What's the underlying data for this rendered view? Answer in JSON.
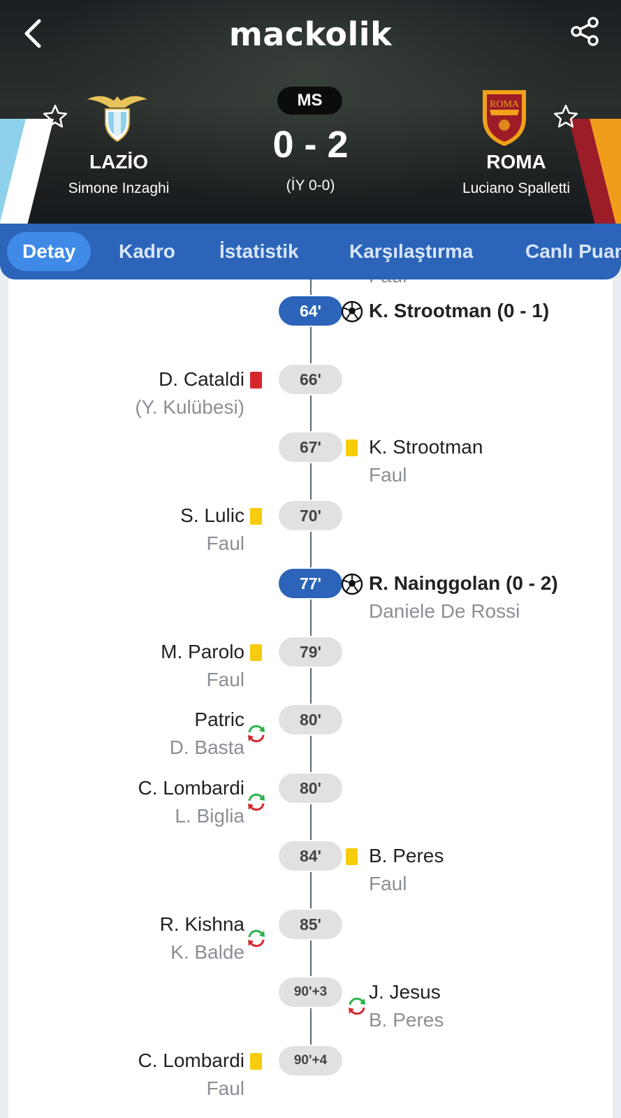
{
  "app": {
    "brand": "mackolik"
  },
  "match": {
    "status": "MS",
    "score": "0 - 2",
    "halftime": "(İY 0-0)",
    "home": {
      "name": "LAZİO",
      "coach": "Simone Inzaghi",
      "crest_color": "#8fd0ec"
    },
    "away": {
      "name": "ROMA",
      "coach": "Luciano Spalletti",
      "crest_color": "#9c1c27"
    }
  },
  "tabs": [
    {
      "label": "Detay",
      "active": true
    },
    {
      "label": "Kadro"
    },
    {
      "label": "İstatistik"
    },
    {
      "label": "Karşılaştırma"
    },
    {
      "label": "Canlı Puan"
    }
  ],
  "timeline": {
    "partial_top_text": "Faul",
    "events": [
      {
        "minute": "64'",
        "side": "away",
        "type": "goal",
        "primary": "K. Strootman (0 - 1)",
        "secondary": ""
      },
      {
        "minute": "66'",
        "side": "home",
        "type": "red-card",
        "primary": "D. Cataldi",
        "secondary": "(Y. Kulübesi)"
      },
      {
        "minute": "67'",
        "side": "away",
        "type": "yellow-card",
        "primary": "K. Strootman",
        "secondary": "Faul"
      },
      {
        "minute": "70'",
        "side": "home",
        "type": "yellow-card",
        "primary": "S. Lulic",
        "secondary": "Faul"
      },
      {
        "minute": "77'",
        "side": "away",
        "type": "goal",
        "primary": "R. Nainggolan (0 - 2)",
        "secondary": "Daniele De Rossi"
      },
      {
        "minute": "79'",
        "side": "home",
        "type": "yellow-card",
        "primary": "M. Parolo",
        "secondary": "Faul"
      },
      {
        "minute": "80'",
        "side": "home",
        "type": "substitution",
        "primary": "Patric",
        "secondary": "D. Basta"
      },
      {
        "minute": "80'",
        "side": "home",
        "type": "substitution",
        "primary": "C. Lombardi",
        "secondary": "L. Biglia"
      },
      {
        "minute": "84'",
        "side": "away",
        "type": "yellow-card",
        "primary": "B. Peres",
        "secondary": "Faul"
      },
      {
        "minute": "85'",
        "side": "home",
        "type": "substitution",
        "primary": "R. Kishna",
        "secondary": "K. Balde"
      },
      {
        "minute": "90'+3",
        "side": "away",
        "type": "substitution",
        "primary": "J. Jesus",
        "secondary": "B. Peres"
      },
      {
        "minute": "90'+4",
        "side": "home",
        "type": "yellow-card",
        "primary": "C. Lombardi",
        "secondary": "Faul"
      }
    ]
  },
  "colors": {
    "accent": "#2b64b8",
    "tab_active": "#3f8ae6",
    "yellow_card": "#f6cc0c",
    "red_card": "#d8262d",
    "sub_in": "#2bb24c",
    "sub_out": "#d8262d"
  }
}
